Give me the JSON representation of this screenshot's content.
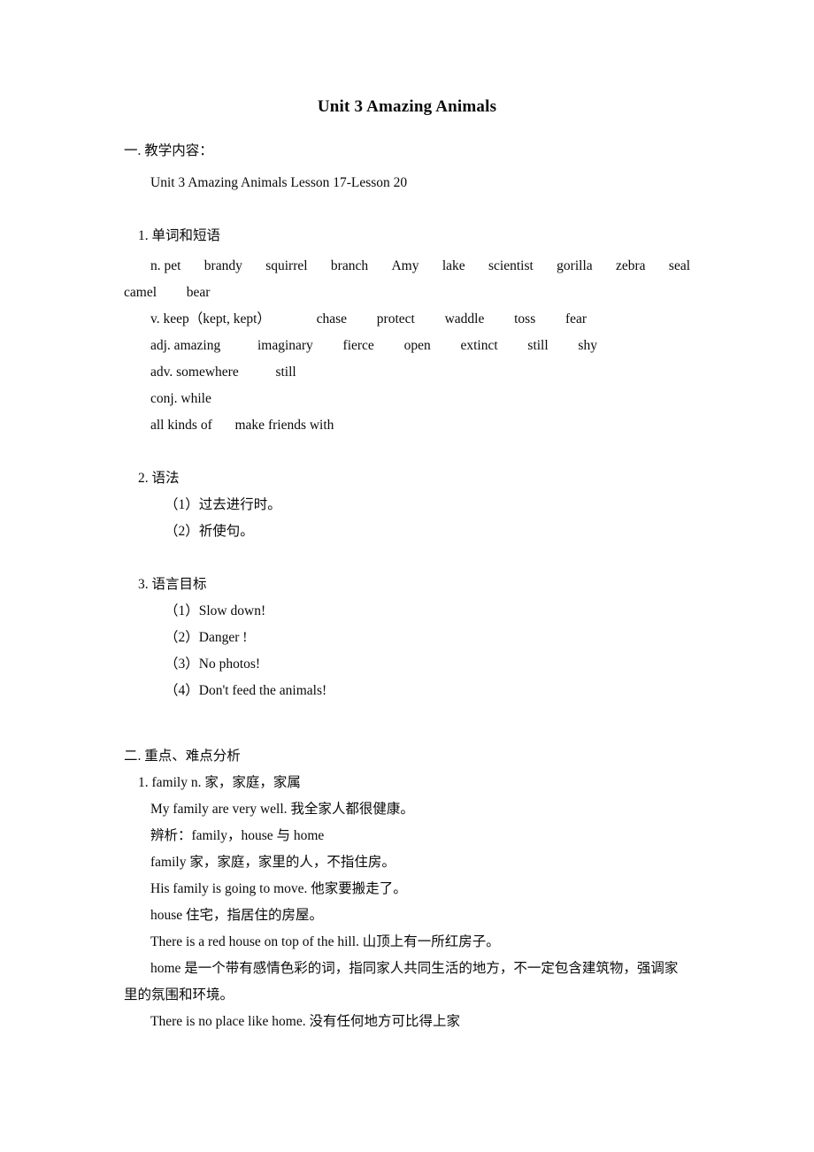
{
  "document": {
    "title": "Unit 3 Amazing Animals",
    "page_background": "#ffffff",
    "text_color": "#0a0a0a"
  },
  "section_one": {
    "heading": "一. 教学内容：",
    "scope": "Unit 3 Amazing Animals Lesson 17-Lesson 20",
    "sub1": {
      "number": "1.",
      "heading": "单词和短语",
      "nouns_label": "n. pet",
      "nouns": [
        "brandy",
        "squirrel",
        "branch",
        "Amy",
        "lake",
        "scientist",
        "gorilla",
        "zebra",
        "seal"
      ],
      "nouns_wrap": [
        "camel",
        "bear"
      ],
      "verbs_label": "v. keep（kept, kept）",
      "verbs": [
        "chase",
        "protect",
        "waddle",
        "toss",
        "fear"
      ],
      "adj_label": "adj. amazing",
      "adjectives": [
        "imaginary",
        "fierce",
        "open",
        "extinct",
        "still",
        "shy"
      ],
      "adv_label": "adv. somewhere",
      "adverbs": [
        "still"
      ],
      "conj_label": "conj. while",
      "phrases": [
        "all kinds of",
        "make friends with"
      ]
    },
    "sub2": {
      "number": "2.",
      "heading": "语法",
      "items": [
        "（1）过去进行时。",
        "（2）祈使句。"
      ]
    },
    "sub3": {
      "number": "3.",
      "heading": "语言目标",
      "items": [
        "（1）Slow down!",
        "（2）Danger !",
        "（3）No photos!",
        "（4）Don't feed the animals!"
      ]
    }
  },
  "section_two": {
    "heading": "二. 重点、难点分析",
    "entry1": {
      "number": "1.",
      "headword": "family n. 家，家庭，家属",
      "example1": "My family are very well. 我全家人都很健康。",
      "compare_label": "辨析：family，house 与 home",
      "family_def": "family 家，家庭，家里的人，不指住房。",
      "family_example": "His family is going to move. 他家要搬走了。",
      "house_def": "house 住宅，指居住的房屋。",
      "house_example": "There is a red house on top of the hill. 山顶上有一所红房子。",
      "home_def": "home 是一个带有感情色彩的词，指同家人共同生活的地方，不一定包含建筑物，强调家里的氛围和环境。",
      "home_example": "There is no place like home. 没有任何地方可比得上家"
    }
  }
}
